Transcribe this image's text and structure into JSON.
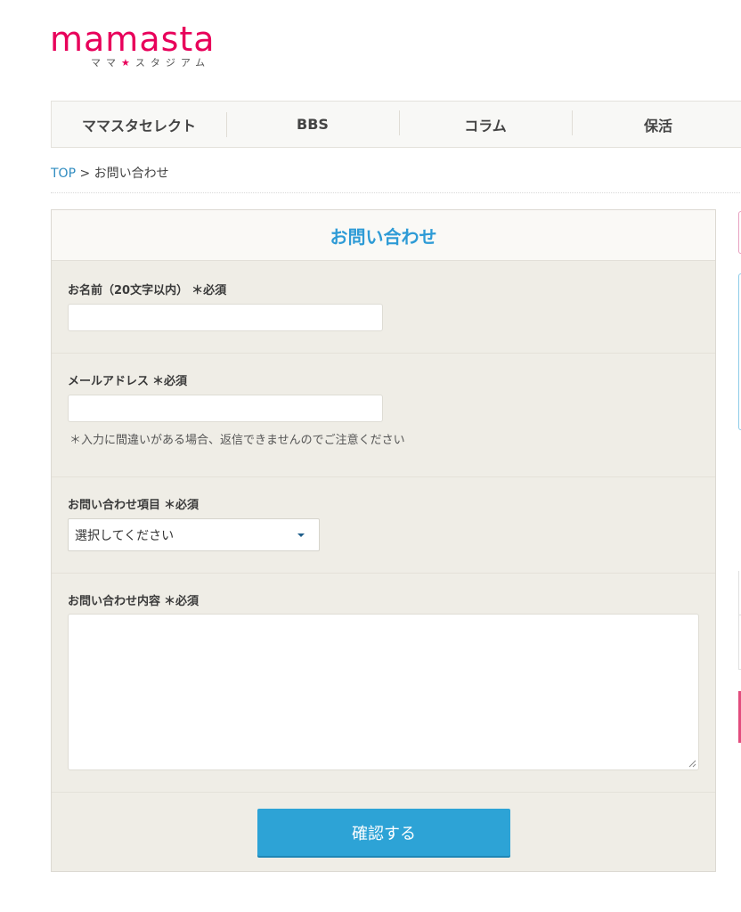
{
  "logo": {
    "word": "mamasta",
    "sub_left": "ママ",
    "sub_star": "★",
    "sub_right": "スタジアム"
  },
  "nav": {
    "items": [
      {
        "label": "ママスタセレクト"
      },
      {
        "label": "BBS"
      },
      {
        "label": "コラム"
      },
      {
        "label": "保活"
      }
    ]
  },
  "breadcrumb": {
    "home": "TOP",
    "separator": " > ",
    "current": "お問い合わせ"
  },
  "form": {
    "title": "お問い合わせ",
    "name": {
      "label": "お名前（20文字以内）",
      "required": "＊必須",
      "value": ""
    },
    "email": {
      "label": "メールアドレス",
      "required": "＊必須",
      "value": "",
      "note": "＊入力に間違いがある場合、返信できませんのでご注意ください"
    },
    "category": {
      "label": "お問い合わせ項目",
      "required": "＊必須",
      "selected": "選択してください"
    },
    "content": {
      "label": "お問い合わせ内容",
      "required": "＊必須",
      "value": ""
    },
    "submit_label": "確認する"
  },
  "colors": {
    "brand": "#e8005a",
    "accent": "#2da3d6",
    "panel_bg": "#efede6"
  }
}
